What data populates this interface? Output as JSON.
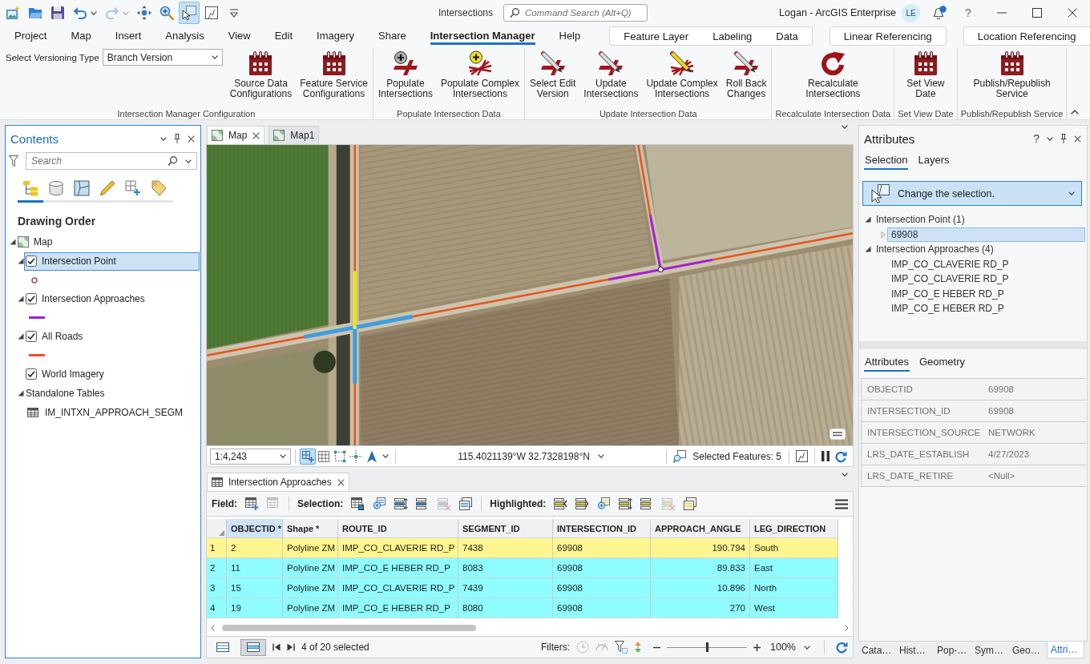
{
  "title_bar": {
    "quick_access": [
      {
        "kind": "new",
        "selected": false,
        "disabled": false
      },
      {
        "kind": "open",
        "selected": false,
        "disabled": false
      },
      {
        "kind": "save",
        "selected": false,
        "disabled": false
      },
      {
        "kind": "undo",
        "selected": false,
        "disabled": false
      },
      {
        "kind": "redo",
        "selected": false,
        "disabled": true
      },
      {
        "kind": "explore",
        "selected": false,
        "disabled": false
      },
      {
        "kind": "zoom",
        "selected": false,
        "disabled": false
      },
      {
        "kind": "select",
        "selected": true,
        "disabled": false
      },
      {
        "kind": "frame",
        "selected": false,
        "disabled": false
      },
      {
        "kind": "customize",
        "selected": false,
        "disabled": false
      }
    ],
    "document_title": "Intersections",
    "command_search": {
      "placeholder": "Command Search (Alt+Q)"
    },
    "user": "Logan - ArcGIS Enterprise",
    "avatar": "LE",
    "notifications_unread": true,
    "help": "?"
  },
  "ribbon": {
    "tabs": [
      {
        "label": "Project",
        "selected": false
      },
      {
        "label": "Map",
        "selected": false
      },
      {
        "label": "Insert",
        "selected": false
      },
      {
        "label": "Analysis",
        "selected": false
      },
      {
        "label": "View",
        "selected": false
      },
      {
        "label": "Edit",
        "selected": false
      },
      {
        "label": "Imagery",
        "selected": false
      },
      {
        "label": "Share",
        "selected": false
      },
      {
        "label": "Intersection Manager",
        "selected": true
      },
      {
        "label": "Help",
        "selected": false
      }
    ],
    "contextual_groups": [
      {
        "tabs": [
          {
            "label": "Feature Layer",
            "selected": false
          },
          {
            "label": "Labeling",
            "selected": false
          },
          {
            "label": "Data",
            "selected": false
          }
        ]
      },
      {
        "tabs": [
          {
            "label": "Linear Referencing",
            "selected": false
          }
        ]
      },
      {
        "tabs": [
          {
            "label": "Location Referencing",
            "selected": false
          }
        ]
      }
    ],
    "groups": [
      {
        "label": "Intersection Manager Configuration",
        "versioning": {
          "label": "Select Versioning Type",
          "value": "Branch Version"
        },
        "buttons": [
          {
            "label": "Source Data\nConfigurations",
            "kind": "calendar"
          },
          {
            "label": "Feature Service\nConfigurations",
            "kind": "calendar"
          }
        ]
      },
      {
        "label": "Populate Intersection Data",
        "buttons": [
          {
            "label": "Populate\nIntersections",
            "kind": "add"
          },
          {
            "label": "Populate Complex\nIntersections",
            "kind": "addcomplex"
          }
        ]
      },
      {
        "label": "Update Intersection Data",
        "buttons": [
          {
            "label": "Select Edit\nVersion",
            "kind": "pencil"
          },
          {
            "label": "Update\nIntersections",
            "kind": "pencil"
          },
          {
            "label": "Update Complex\nIntersections",
            "kind": "pencilcomplex"
          },
          {
            "label": "Roll Back\nChanges",
            "kind": "pencil"
          }
        ]
      },
      {
        "label": "Recalculate Intersection Data",
        "buttons": [
          {
            "label": "Recalculate\nIntersections",
            "kind": "refresh"
          }
        ]
      },
      {
        "label": "Set View Date",
        "buttons": [
          {
            "label": "Set View\nDate",
            "kind": "calendar"
          }
        ]
      },
      {
        "label": "Publish/Republish Service",
        "buttons": [
          {
            "label": "Publish/Republish\nService",
            "kind": "calendar"
          }
        ]
      }
    ]
  },
  "contents": {
    "title": "Contents",
    "search": {
      "placeholder": "Search"
    },
    "views": [
      {
        "kind": "order",
        "selected": true
      },
      {
        "kind": "source",
        "selected": false
      },
      {
        "kind": "selection",
        "selected": false
      },
      {
        "kind": "editing",
        "selected": false
      },
      {
        "kind": "snapping",
        "selected": false
      },
      {
        "kind": "labeling",
        "selected": false
      }
    ],
    "heading": "Drawing Order",
    "tree": [
      {
        "label": "Map",
        "kind": "map",
        "expanded": true,
        "selected": false,
        "children": [
          {
            "label": "Intersection Point",
            "kind": "layer",
            "expanded": true,
            "checked": true,
            "selected": true,
            "symbol": {
              "kind": "point",
              "color": "#9c4f6c"
            }
          },
          {
            "label": "Intersection Approaches",
            "kind": "layer",
            "expanded": true,
            "checked": true,
            "selected": false,
            "symbol": {
              "kind": "line",
              "color": "#a31fd6"
            }
          },
          {
            "label": "All Roads",
            "kind": "layer",
            "expanded": true,
            "checked": true,
            "selected": false,
            "symbol": {
              "kind": "line",
              "color": "#e8531d"
            }
          },
          {
            "label": "World Imagery",
            "kind": "layer",
            "checked": true,
            "selected": false
          },
          {
            "label": "Standalone Tables",
            "kind": "group",
            "expanded": true,
            "selected": false,
            "children": [
              {
                "label": "IM_INTXN_APPROACH_SEGM",
                "kind": "table",
                "selected": false
              }
            ]
          }
        ]
      }
    ]
  },
  "map_view": {
    "tabs": [
      {
        "label": "Map",
        "selected": true
      },
      {
        "label": "Map1",
        "selected": false
      }
    ],
    "status_bar": {
      "scale": "1:4,243",
      "toggles": [
        {
          "kind": "snapping",
          "selected": true
        },
        {
          "kind": "grid",
          "selected": false
        },
        {
          "kind": "constraints",
          "selected": false
        },
        {
          "kind": "correction",
          "selected": false
        },
        {
          "kind": "north",
          "selected": false
        }
      ],
      "coordinates": "115.4021139°W 32.7328198°N",
      "selected_features": "Selected Features: 5"
    }
  },
  "table_view": {
    "tab": {
      "label": "Intersection Approaches"
    },
    "toolbar": [
      {
        "label": "Field:",
        "tools": [
          {
            "kind": "addfield",
            "disabled": false
          },
          {
            "kind": "calcfield",
            "disabled": true
          }
        ]
      },
      {
        "label": "Selection:",
        "tools": [
          {
            "kind": "selectattr",
            "disabled": false
          },
          {
            "kind": "zoomto",
            "disabled": false
          },
          {
            "kind": "switch",
            "disabled": false
          },
          {
            "kind": "list",
            "disabled": false
          },
          {
            "kind": "clear",
            "disabled": true
          },
          {
            "kind": "copy",
            "disabled": false
          }
        ]
      },
      {
        "label": "Highlighted:",
        "tools": [
          {
            "kind": "hlreselect",
            "disabled": false
          },
          {
            "kind": "hlunselect",
            "disabled": false
          },
          {
            "kind": "hlzoomto",
            "disabled": false
          },
          {
            "kind": "hlswitch",
            "disabled": false
          },
          {
            "kind": "hllist",
            "disabled": false
          },
          {
            "kind": "hlclear",
            "disabled": true
          },
          {
            "kind": "hlcopy",
            "disabled": false
          }
        ]
      }
    ],
    "columns": [
      {
        "label": "OBJECTID *",
        "kind": "text",
        "selected": true
      },
      {
        "label": "Shape *",
        "kind": "text",
        "selected": false
      },
      {
        "label": "ROUTE_ID",
        "kind": "text",
        "selected": false
      },
      {
        "label": "SEGMENT_ID",
        "kind": "text",
        "selected": false
      },
      {
        "label": "INTERSECTION_ID",
        "kind": "text",
        "selected": false
      },
      {
        "label": "APPROACH_ANGLE",
        "kind": "number",
        "selected": false
      },
      {
        "label": "LEG_DIRECTION",
        "kind": "text",
        "selected": false
      }
    ],
    "rows": [
      {
        "number": "1",
        "selected": true,
        "highlighted": true,
        "cells": [
          "2",
          "Polyline ZM",
          "IMP_CO_CLAVERIE RD_P",
          "7438",
          "69908",
          "190.794",
          "South"
        ]
      },
      {
        "number": "2",
        "selected": true,
        "highlighted": false,
        "cells": [
          "11",
          "Polyline ZM",
          "IMP_CO_E HEBER RD_P",
          "8083",
          "69908",
          "89.833",
          "East"
        ]
      },
      {
        "number": "3",
        "selected": true,
        "highlighted": false,
        "cells": [
          "15",
          "Polyline ZM",
          "IMP_CO_CLAVERIE RD_P",
          "7439",
          "69908",
          "10.896",
          "North"
        ]
      },
      {
        "number": "4",
        "selected": true,
        "highlighted": false,
        "cells": [
          "19",
          "Polyline ZM",
          "IMP_CO_E HEBER RD_P",
          "8080",
          "69908",
          "270",
          "West"
        ]
      }
    ],
    "footer": {
      "views": [
        {
          "kind": "all",
          "selected": false
        },
        {
          "kind": "selected",
          "selected": true
        }
      ],
      "selection_count": "4 of 20 selected",
      "filters_label": "Filters:",
      "filters": [
        {
          "kind": "time",
          "disabled": true
        },
        {
          "kind": "range",
          "disabled": true
        },
        {
          "kind": "extent",
          "disabled": false
        },
        {
          "kind": "scale",
          "disabled": false
        }
      ],
      "zoom": {
        "level": 0.5,
        "value": "100%"
      }
    }
  },
  "attributes": {
    "title": "Attributes",
    "help": "?",
    "tabs": [
      {
        "label": "Selection",
        "selected": true
      },
      {
        "label": "Layers",
        "selected": false
      }
    ],
    "selection_prompt": "Change the selection.",
    "tree": [
      {
        "label": "Intersection Point (1)",
        "expanded": true,
        "selected": false,
        "children": [
          {
            "label": "69908",
            "expanded": false,
            "selected": true
          }
        ]
      },
      {
        "label": "Intersection Approaches (4)",
        "expanded": true,
        "selected": false,
        "children": [
          {
            "label": "IMP_CO_CLAVERIE RD_P",
            "selected": false
          },
          {
            "label": "IMP_CO_CLAVERIE RD_P",
            "selected": false
          },
          {
            "label": "IMP_CO_E HEBER RD_P",
            "selected": false
          },
          {
            "label": "IMP_CO_E HEBER RD_P",
            "selected": false
          }
        ]
      }
    ],
    "detail_tabs": [
      {
        "label": "Attributes",
        "selected": true
      },
      {
        "label": "Geometry",
        "selected": false
      }
    ],
    "fields": [
      {
        "name": "OBJECTID",
        "value": "69908"
      },
      {
        "name": "INTERSECTION_ID",
        "value": "69908"
      },
      {
        "name": "INTERSECTION_SOURCE",
        "value": "NETWORK"
      },
      {
        "name": "LRS_DATE_ESTABLISH",
        "value": "4/27/2023"
      },
      {
        "name": "LRS_DATE_RETIRE",
        "value": "<Null>"
      }
    ],
    "dock_tabs": [
      {
        "label": "Cata…",
        "selected": false
      },
      {
        "label": "Hist…",
        "selected": false
      },
      {
        "label": "Pop-…",
        "selected": false
      },
      {
        "label": "Sym…",
        "selected": false
      },
      {
        "label": "Geo…",
        "selected": false
      },
      {
        "label": "Attri…",
        "selected": true
      }
    ]
  }
}
